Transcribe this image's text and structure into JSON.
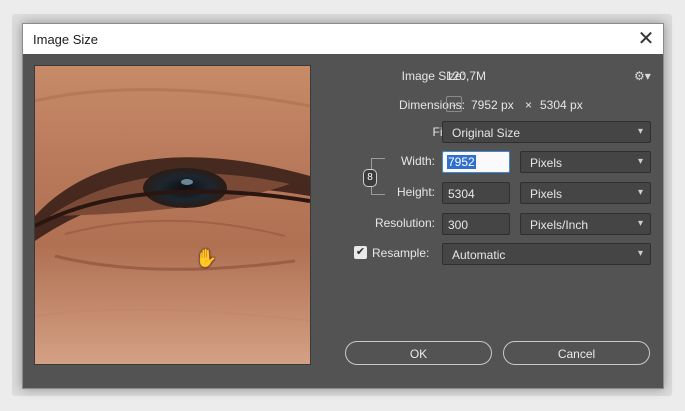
{
  "window": {
    "title": "Image Size"
  },
  "info": {
    "image_size_label": "Image Size:",
    "image_size_value": "120,7M",
    "dimensions_label": "Dimensions:",
    "dimensions_width": "7952 px",
    "dimensions_times": "×",
    "dimensions_height": "5304 px",
    "fit_to_label": "Fit To:",
    "fit_to_value": "Original Size"
  },
  "fields": {
    "width_label": "Width:",
    "width_value": "7952",
    "width_unit": "Pixels",
    "height_label": "Height:",
    "height_value": "5304",
    "height_unit": "Pixels",
    "resolution_label": "Resolution:",
    "resolution_value": "300",
    "resolution_unit": "Pixels/Inch",
    "resample_label": "Resample:",
    "resample_checked": true,
    "resample_value": "Automatic"
  },
  "buttons": {
    "ok": "OK",
    "cancel": "Cancel"
  },
  "icons": {
    "close": "close-icon",
    "gear": "gear-icon",
    "chain": "link-chain-icon",
    "hand": "hand-cursor-icon",
    "check": "checkmark-icon"
  }
}
